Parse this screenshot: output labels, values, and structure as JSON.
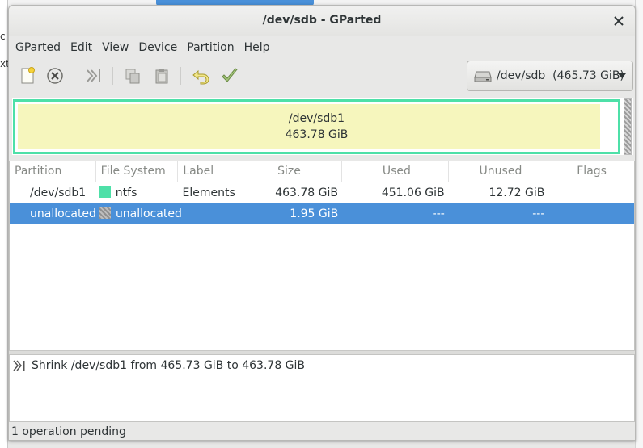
{
  "window": {
    "title": "/dev/sdb - GParted"
  },
  "menubar": {
    "items": [
      "GParted",
      "Edit",
      "View",
      "Device",
      "Partition",
      "Help"
    ]
  },
  "toolbar": {
    "buttons": [
      "new-partition-icon",
      "delete-partition-icon",
      "resize-move-icon",
      "copy-icon",
      "paste-icon",
      "undo-icon",
      "apply-icon"
    ]
  },
  "device_selector": {
    "label": "/dev/sdb  (465.73 GiB)",
    "icon": "hard-disk-icon"
  },
  "disk_map": {
    "partition": {
      "name": "/dev/sdb1",
      "size": "463.78 GiB",
      "color": "#4ee0a8",
      "fill_color": "#f6f6bd",
      "used_fraction": 0.97
    },
    "unallocated_color": "#9b9b9b"
  },
  "table": {
    "columns": [
      "Partition",
      "File System",
      "Label",
      "Size",
      "Used",
      "Unused",
      "Flags"
    ],
    "rows": [
      {
        "partition": "/dev/sdb1",
        "filesystem": "ntfs",
        "fs_color": "#4ee0a8",
        "label": "Elements",
        "size": "463.78 GiB",
        "used": "451.06 GiB",
        "unused": "12.72 GiB",
        "flags": ""
      },
      {
        "partition": "unallocated",
        "filesystem": "unallocated",
        "fs_color": "#9b9b9b",
        "label": "",
        "size": "1.95 GiB",
        "used": "---",
        "unused": "---",
        "flags": "",
        "selected": true
      }
    ]
  },
  "operations": [
    {
      "icon": "resize-move-icon",
      "text": "Shrink /dev/sdb1 from 465.73 GiB to 463.78 GiB"
    }
  ],
  "status": {
    "text": "1 operation pending"
  },
  "colors": {
    "selection": "#4a90d9",
    "ntfs": "#4ee0a8"
  }
}
